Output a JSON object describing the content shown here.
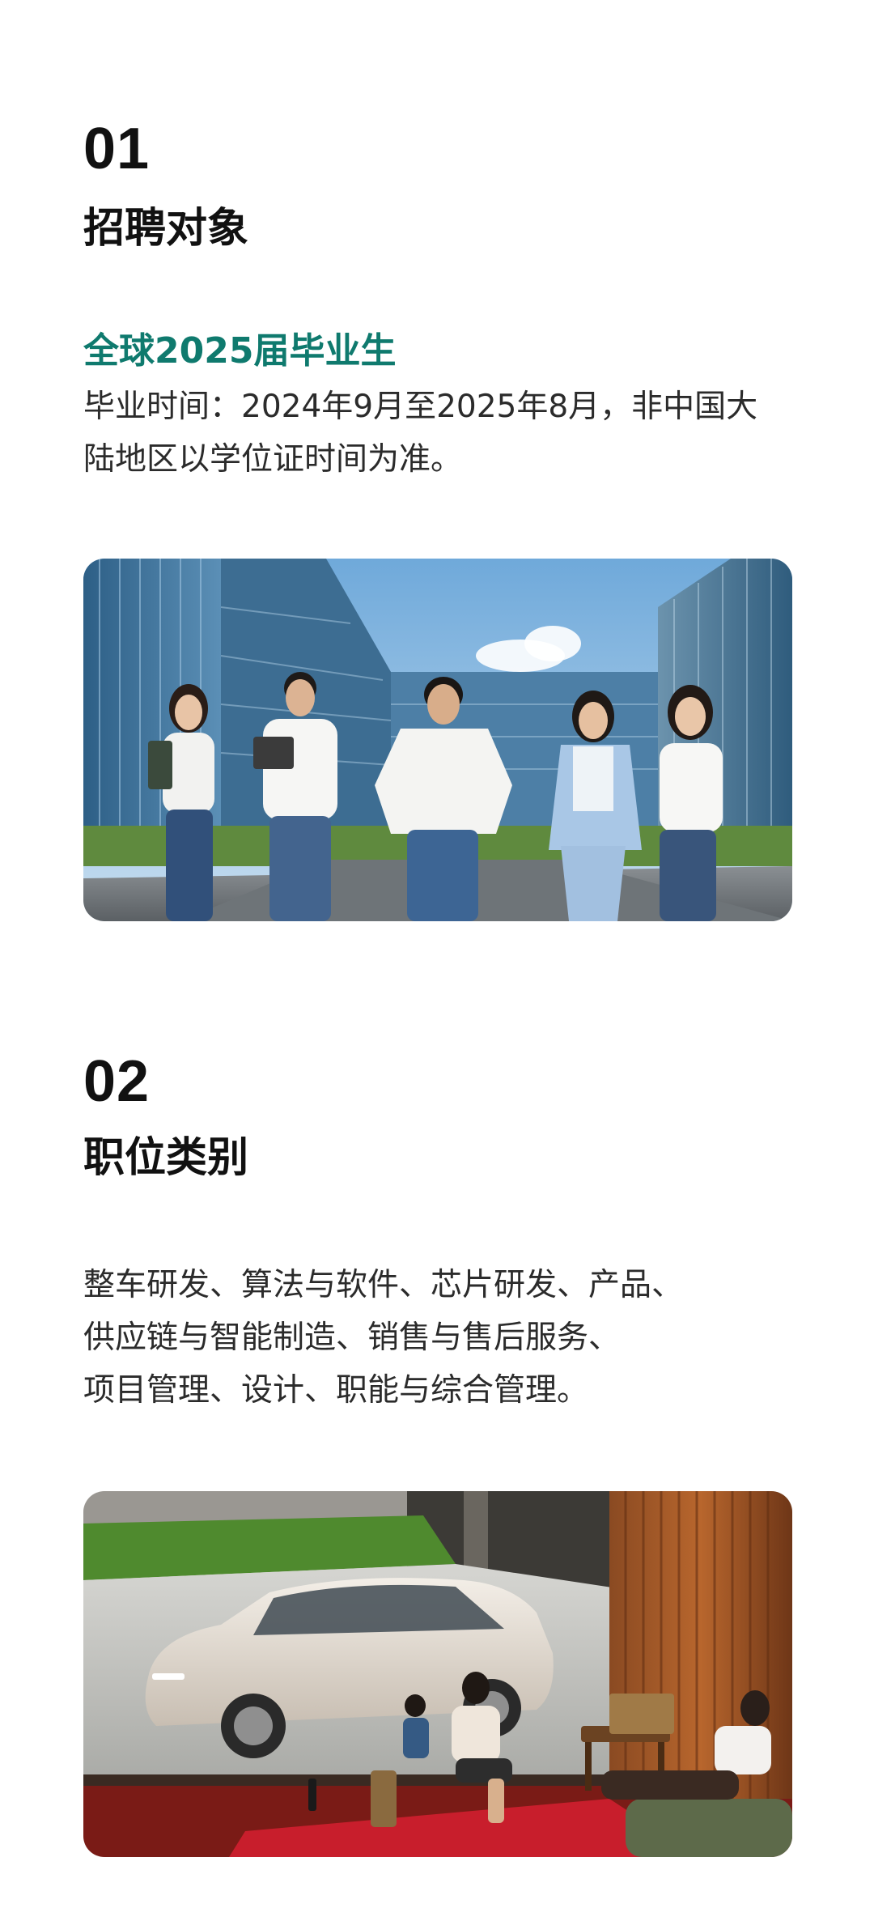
{
  "section1": {
    "number": "01",
    "title": "招聘对象",
    "highlight": "全球2025届毕业生",
    "description_line1": "毕业时间：2024年9月至2025年8月，非中国大",
    "description_line2": "陆地区以学位证时间为准。",
    "image_subject": "five graduates walking on campus"
  },
  "section2": {
    "number": "02",
    "title": "职位类别",
    "categories_line1": "整车研发、算法与软件、芯片研发、产品、",
    "categories_line2": "供应链与智能制造、销售与售后服务、",
    "categories_line3": "项目管理、设计、职能与综合管理。",
    "image_subject": "white SUV parked outside a wooden living room with a family"
  },
  "colors": {
    "accent": "#0f7a6e",
    "heading": "#111111",
    "body": "#2b2b2b",
    "background": "#ffffff"
  }
}
